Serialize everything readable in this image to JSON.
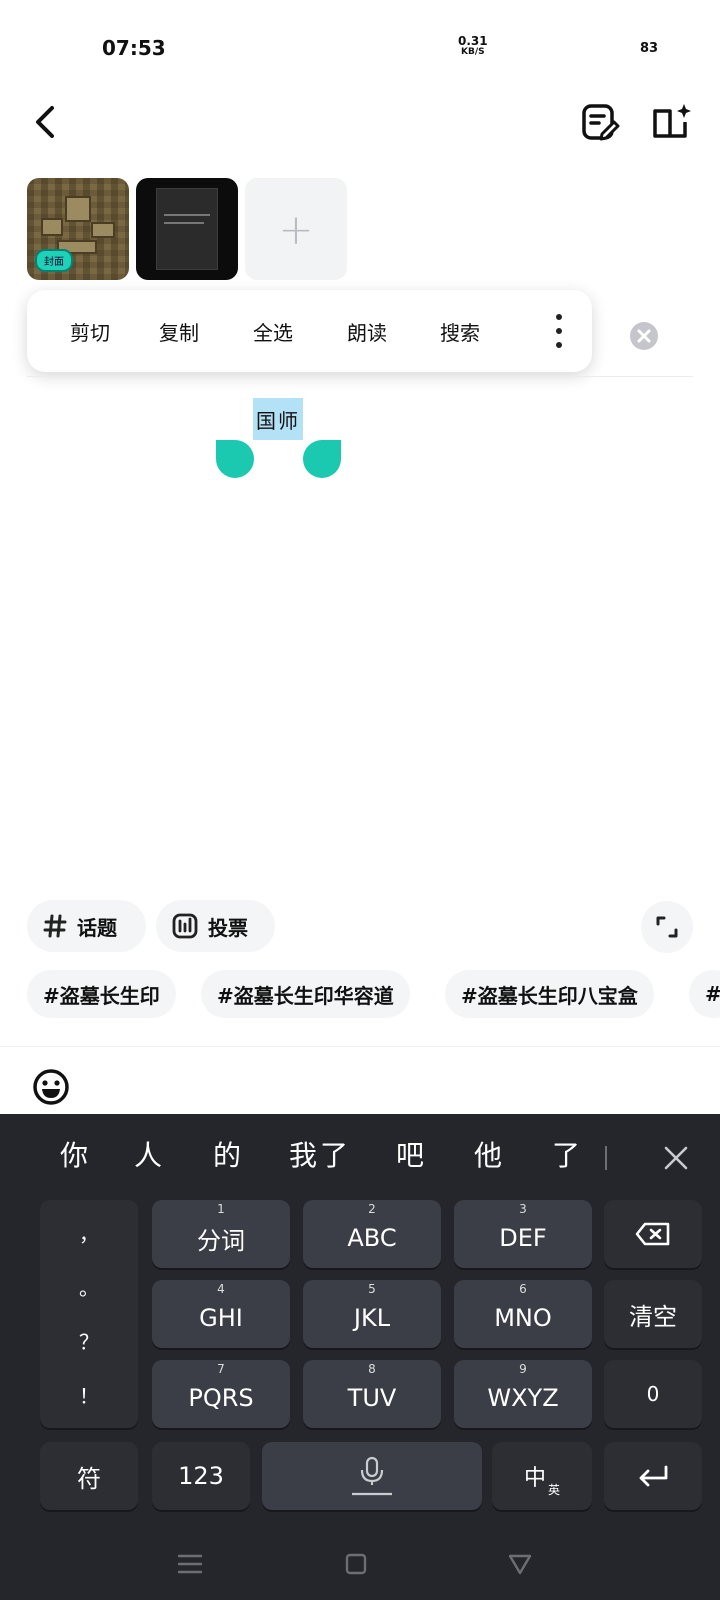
{
  "status": {
    "time": "07:53",
    "net_speed": "0.31",
    "net_unit": "KB/S",
    "battery": "83"
  },
  "thumbnails": {
    "cover_badge": "封面",
    "add": "+"
  },
  "context_menu": {
    "items": [
      "剪切",
      "复制",
      "全选",
      "朗读",
      "搜索"
    ]
  },
  "editor": {
    "selected_text": "国师"
  },
  "chips": {
    "topic": "话题",
    "vote": "投票"
  },
  "tags": [
    "#盗墓长生印",
    "#盗墓长生印华容道",
    "#盗墓长生印八宝盒",
    "#"
  ],
  "keyboard": {
    "candidates": [
      "你",
      "人",
      "的",
      "我",
      "了",
      "吧",
      "他",
      "了"
    ],
    "punctuation": [
      "，",
      "。",
      "？",
      "！"
    ],
    "keys": [
      {
        "num": "1",
        "label": "分词"
      },
      {
        "num": "2",
        "label": "ABC"
      },
      {
        "num": "3",
        "label": "DEF"
      },
      {
        "num": "4",
        "label": "GHI"
      },
      {
        "num": "5",
        "label": "JKL"
      },
      {
        "num": "6",
        "label": "MNO"
      },
      {
        "num": "7",
        "label": "PQRS"
      },
      {
        "num": "8",
        "label": "TUV"
      },
      {
        "num": "9",
        "label": "WXYZ"
      }
    ],
    "clear": "清空",
    "zero": "0",
    "symbols": "符",
    "numbers": "123",
    "lang_main": "中",
    "lang_sub": "英"
  },
  "colors": {
    "accent": "#1bc8b0",
    "selection": "#b3e1f5",
    "keyboard_bg": "#24262c"
  }
}
